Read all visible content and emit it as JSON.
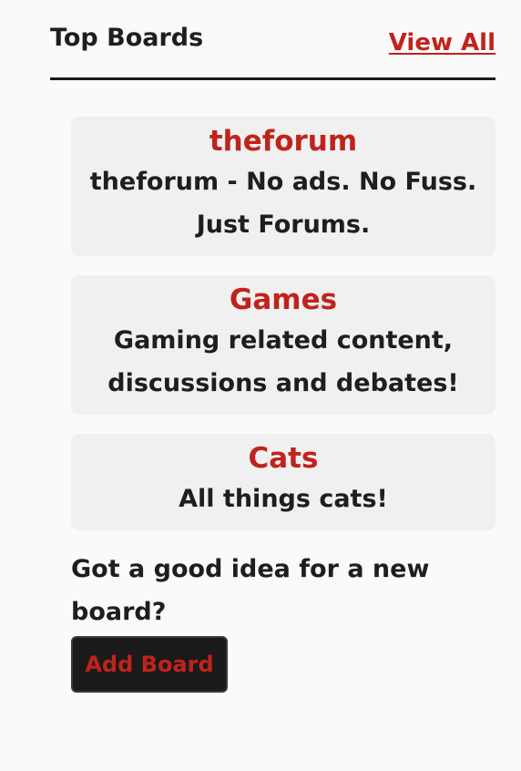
{
  "header": {
    "title": "Top Boards",
    "view_all_label": "View All"
  },
  "boards": [
    {
      "name": "theforum",
      "description": "theforum - No ads. No Fuss. Just Forums."
    },
    {
      "name": "Games",
      "description": "Gaming related content, discussions and debates!"
    },
    {
      "name": "Cats",
      "description": "All things cats!"
    }
  ],
  "prompt": {
    "text": "Got a good idea for a new board?",
    "button_label": "Add Board"
  },
  "colors": {
    "accent": "#c0231c",
    "text": "#1e1e1e",
    "card_bg": "#f0f0f0",
    "button_bg": "#1a1a1a",
    "page_bg": "#fafafa"
  }
}
